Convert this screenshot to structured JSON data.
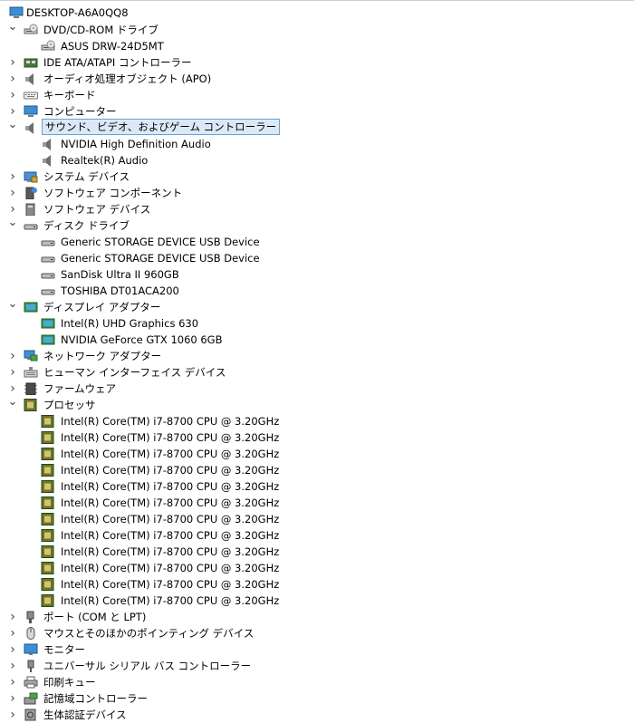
{
  "root": "DESKTOP-A6A0QQ8",
  "categories": [
    {
      "label": "DVD/CD-ROM ドライブ",
      "icon": "dvd-drive-icon",
      "expanded": true,
      "children": [
        {
          "label": "ASUS DRW-24D5MT",
          "icon": "dvd-drive-icon"
        }
      ]
    },
    {
      "label": "IDE ATA/ATAPI コントローラー",
      "icon": "ide-controller-icon",
      "expanded": false,
      "children": []
    },
    {
      "label": "オーディオ処理オブジェクト (APO)",
      "icon": "speaker-icon",
      "expanded": false,
      "children": []
    },
    {
      "label": "キーボード",
      "icon": "keyboard-icon",
      "expanded": false,
      "children": []
    },
    {
      "label": "コンピューター",
      "icon": "computer-icon",
      "expanded": false,
      "children": []
    },
    {
      "label": "サウンド、ビデオ、およびゲーム コントローラー",
      "icon": "speaker-icon",
      "expanded": true,
      "selected": true,
      "children": [
        {
          "label": "NVIDIA High Definition Audio",
          "icon": "speaker-icon"
        },
        {
          "label": "Realtek(R) Audio",
          "icon": "speaker-icon"
        }
      ]
    },
    {
      "label": "システム デバイス",
      "icon": "system-device-icon",
      "expanded": false,
      "children": []
    },
    {
      "label": "ソフトウェア コンポーネント",
      "icon": "software-component-icon",
      "expanded": false,
      "children": []
    },
    {
      "label": "ソフトウェア デバイス",
      "icon": "software-device-icon",
      "expanded": false,
      "children": []
    },
    {
      "label": "ディスク ドライブ",
      "icon": "disk-drive-icon",
      "expanded": true,
      "children": [
        {
          "label": "Generic STORAGE DEVICE USB Device",
          "icon": "disk-drive-icon"
        },
        {
          "label": "Generic STORAGE DEVICE USB Device",
          "icon": "disk-drive-icon"
        },
        {
          "label": "SanDisk Ultra II 960GB",
          "icon": "disk-drive-icon"
        },
        {
          "label": "TOSHIBA DT01ACA200",
          "icon": "disk-drive-icon"
        }
      ]
    },
    {
      "label": "ディスプレイ アダプター",
      "icon": "display-adapter-icon",
      "expanded": true,
      "children": [
        {
          "label": "Intel(R) UHD Graphics 630",
          "icon": "display-adapter-icon"
        },
        {
          "label": "NVIDIA GeForce GTX 1060 6GB",
          "icon": "display-adapter-icon"
        }
      ]
    },
    {
      "label": "ネットワーク アダプター",
      "icon": "network-adapter-icon",
      "expanded": false,
      "children": []
    },
    {
      "label": "ヒューマン インターフェイス デバイス",
      "icon": "hid-icon",
      "expanded": false,
      "children": []
    },
    {
      "label": "ファームウェア",
      "icon": "firmware-icon",
      "expanded": false,
      "children": []
    },
    {
      "label": "プロセッサ",
      "icon": "processor-icon",
      "expanded": true,
      "children": [
        {
          "label": "Intel(R) Core(TM) i7-8700 CPU @ 3.20GHz",
          "icon": "processor-icon"
        },
        {
          "label": "Intel(R) Core(TM) i7-8700 CPU @ 3.20GHz",
          "icon": "processor-icon"
        },
        {
          "label": "Intel(R) Core(TM) i7-8700 CPU @ 3.20GHz",
          "icon": "processor-icon"
        },
        {
          "label": "Intel(R) Core(TM) i7-8700 CPU @ 3.20GHz",
          "icon": "processor-icon"
        },
        {
          "label": "Intel(R) Core(TM) i7-8700 CPU @ 3.20GHz",
          "icon": "processor-icon"
        },
        {
          "label": "Intel(R) Core(TM) i7-8700 CPU @ 3.20GHz",
          "icon": "processor-icon"
        },
        {
          "label": "Intel(R) Core(TM) i7-8700 CPU @ 3.20GHz",
          "icon": "processor-icon"
        },
        {
          "label": "Intel(R) Core(TM) i7-8700 CPU @ 3.20GHz",
          "icon": "processor-icon"
        },
        {
          "label": "Intel(R) Core(TM) i7-8700 CPU @ 3.20GHz",
          "icon": "processor-icon"
        },
        {
          "label": "Intel(R) Core(TM) i7-8700 CPU @ 3.20GHz",
          "icon": "processor-icon"
        },
        {
          "label": "Intel(R) Core(TM) i7-8700 CPU @ 3.20GHz",
          "icon": "processor-icon"
        },
        {
          "label": "Intel(R) Core(TM) i7-8700 CPU @ 3.20GHz",
          "icon": "processor-icon"
        }
      ]
    },
    {
      "label": "ポート (COM と LPT)",
      "icon": "port-icon",
      "expanded": false,
      "children": []
    },
    {
      "label": "マウスとそのほかのポインティング デバイス",
      "icon": "mouse-icon",
      "expanded": false,
      "children": []
    },
    {
      "label": "モニター",
      "icon": "monitor-icon",
      "expanded": false,
      "children": []
    },
    {
      "label": "ユニバーサル シリアル バス コントローラー",
      "icon": "usb-icon",
      "expanded": false,
      "children": []
    },
    {
      "label": "印刷キュー",
      "icon": "printer-icon",
      "expanded": false,
      "children": []
    },
    {
      "label": "記憶域コントローラー",
      "icon": "storage-controller-icon",
      "expanded": false,
      "children": []
    },
    {
      "label": "生体認証デバイス",
      "icon": "biometric-icon",
      "expanded": false,
      "children": []
    }
  ]
}
